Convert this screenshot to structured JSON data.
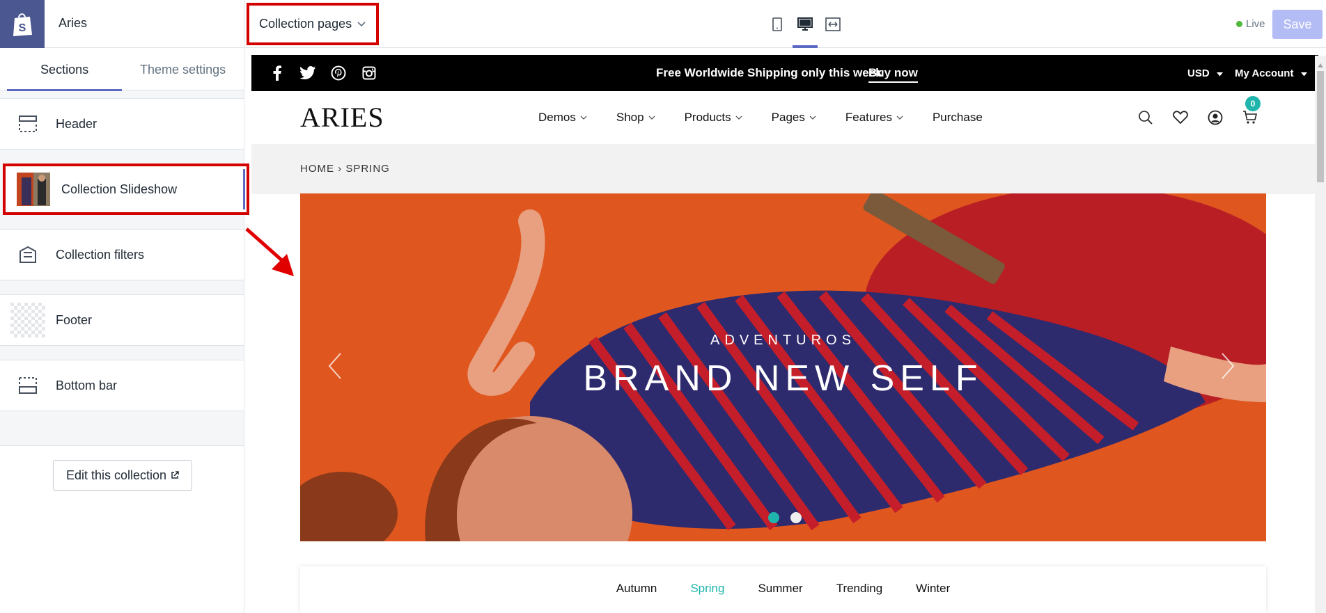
{
  "app": {
    "shop_name": "Aries",
    "template_select": "Collection pages",
    "devices": [
      "mobile-icon",
      "desktop-icon",
      "fullscreen-icon"
    ],
    "status": "Live",
    "save_label": "Save",
    "colors": {
      "accent": "#5c6ac4",
      "highlight": "#d40000",
      "live": "#50b83c",
      "teal": "#1fb5ad"
    }
  },
  "sidebar": {
    "tabs": [
      "Sections",
      "Theme settings"
    ],
    "sections": [
      {
        "label": "Header",
        "icon": "header-icon"
      },
      {
        "label": "Collection Slideshow",
        "icon": "slideshow-thumbnail"
      },
      {
        "label": "Collection filters",
        "icon": "filters-icon"
      },
      {
        "label": "Footer",
        "icon": "footer-icon"
      },
      {
        "label": "Bottom bar",
        "icon": "bottom-bar-icon"
      }
    ],
    "edit_button": "Edit this collection"
  },
  "preview": {
    "announcement": {
      "text": "Free Worldwide Shipping only this week",
      "link": "Buy now"
    },
    "social": [
      "facebook-icon",
      "twitter-icon",
      "pinterest-icon",
      "instagram-icon"
    ],
    "currency": "USD",
    "account": "My Account",
    "brand": "ARIES",
    "nav": [
      "Demos",
      "Shop",
      "Products",
      "Pages",
      "Features",
      "Purchase"
    ],
    "cart_count": "0",
    "breadcrumb": "HOME › SPRING",
    "hero": {
      "kicker": "ADVENTUROS",
      "title": "BRAND NEW SELF"
    },
    "filters": [
      "Autumn",
      "Spring",
      "Summer",
      "Trending",
      "Winter"
    ],
    "active_filter": "Spring"
  }
}
